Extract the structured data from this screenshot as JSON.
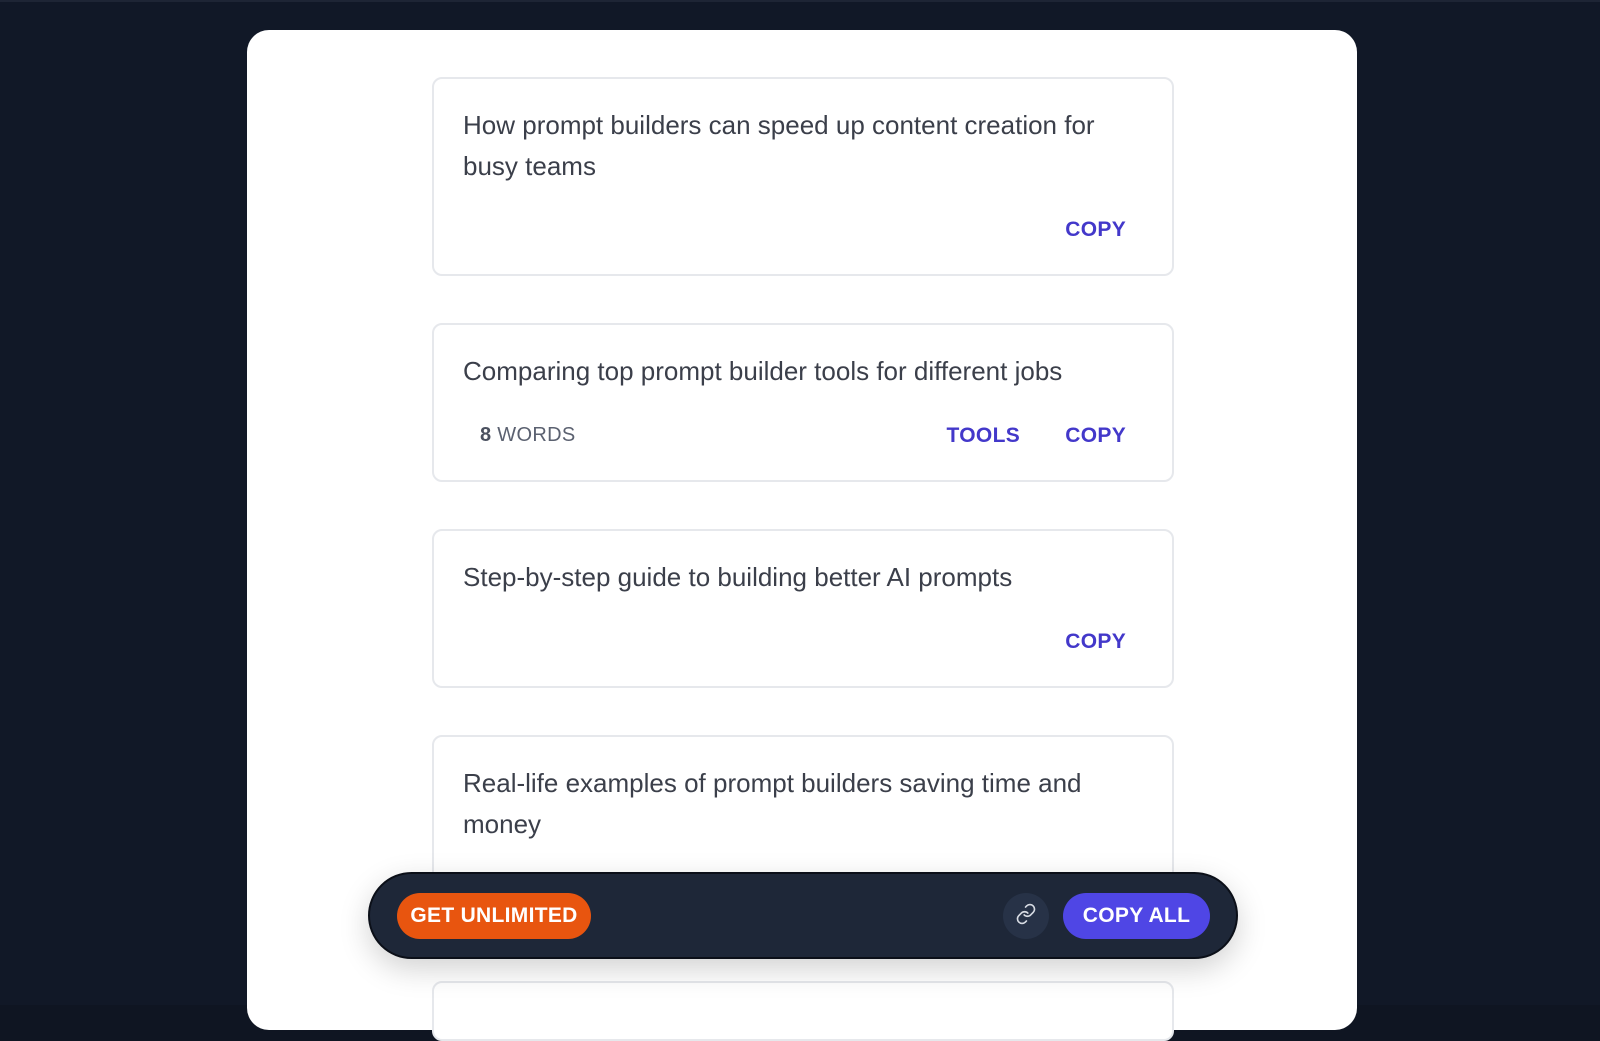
{
  "cards": [
    {
      "text": "How prompt builders can speed up content creation for busy teams",
      "copy_label": "COPY"
    },
    {
      "text": "Comparing top prompt builder tools for different jobs",
      "word_count": "8",
      "words_label": "WORDS",
      "tools_label": "TOOLS",
      "copy_label": "COPY"
    },
    {
      "text": "Step-by-step guide to building better AI prompts",
      "copy_label": "COPY"
    },
    {
      "text": "Real-life examples of prompt builders saving time and money"
    }
  ],
  "bottom_bar": {
    "unlimited_label": "GET UNLIMITED",
    "link_icon": "link-icon",
    "copy_all_label": "COPY ALL"
  },
  "colors": {
    "accent": "#4f46e5",
    "link_text": "#4338ca",
    "orange": "#e8550f",
    "bar_bg": "#1e2738",
    "page_bg": "#111827"
  }
}
